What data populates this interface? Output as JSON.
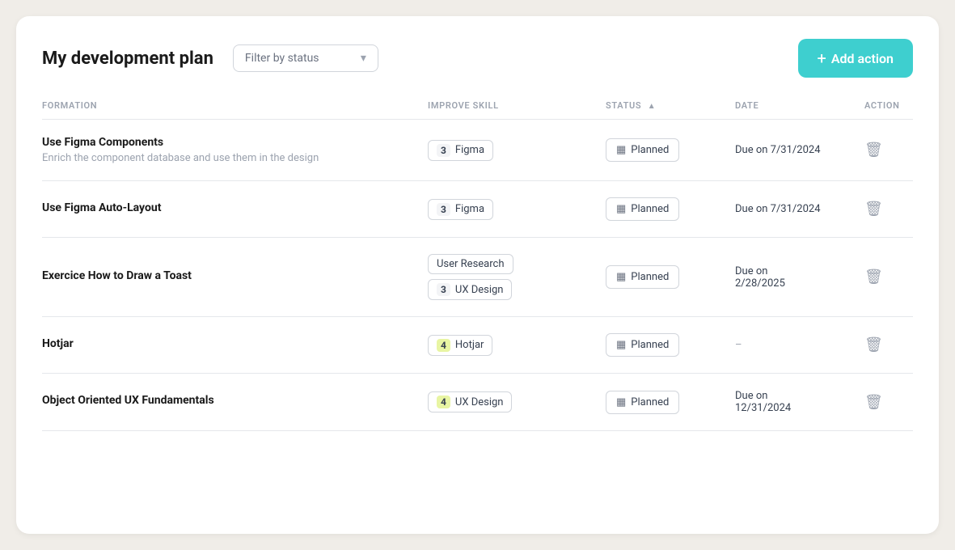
{
  "page": {
    "title": "My development plan"
  },
  "filter": {
    "placeholder": "Filter by status",
    "chevron": "▾"
  },
  "add_action_button": {
    "label": "Add action",
    "plus": "+"
  },
  "table": {
    "columns": [
      {
        "id": "formation",
        "label": "FORMATION"
      },
      {
        "id": "improve_skill",
        "label": "IMPROVE SKILL"
      },
      {
        "id": "status",
        "label": "STATUS"
      },
      {
        "id": "date",
        "label": "DATE"
      },
      {
        "id": "action",
        "label": "ACTION"
      }
    ],
    "rows": [
      {
        "id": "row-1",
        "title": "Use Figma Components",
        "subtitle": "Enrich the component database and use them in the design",
        "skills": [
          {
            "level": "3",
            "label": "Figma",
            "badge_type": "plain"
          }
        ],
        "status": "Planned",
        "date": "Due on 7/31/2024"
      },
      {
        "id": "row-2",
        "title": "Use Figma Auto-Layout",
        "subtitle": "",
        "skills": [
          {
            "level": "3",
            "label": "Figma",
            "badge_type": "plain"
          }
        ],
        "status": "Planned",
        "date": "Due on 7/31/2024"
      },
      {
        "id": "row-3",
        "title": "Exercice How to Draw a Toast",
        "subtitle": "",
        "skills": [
          {
            "level": "",
            "label": "User Research",
            "badge_type": "plain-no-level"
          },
          {
            "level": "3",
            "label": "UX Design",
            "badge_type": "plain"
          }
        ],
        "status": "Planned",
        "date": "Due on\n2/28/2025"
      },
      {
        "id": "row-4",
        "title": "Hotjar",
        "subtitle": "",
        "skills": [
          {
            "level": "4",
            "label": "Hotjar",
            "badge_type": "green"
          }
        ],
        "status": "Planned",
        "date": "–"
      },
      {
        "id": "row-5",
        "title": "Object Oriented UX Fundamentals",
        "subtitle": "",
        "skills": [
          {
            "level": "4",
            "label": "UX Design",
            "badge_type": "green"
          }
        ],
        "status": "Planned",
        "date": "Due on\n12/31/2024"
      }
    ]
  },
  "icons": {
    "calendar": "📅",
    "trash": "🗑",
    "plus": "+",
    "chevron_down": "▾",
    "sort_asc": "▲"
  }
}
